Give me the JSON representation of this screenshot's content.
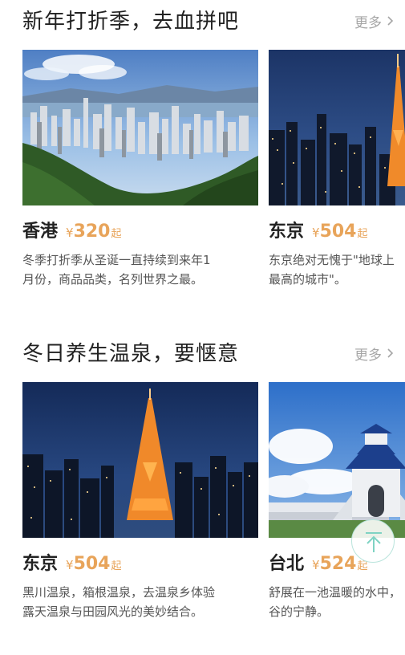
{
  "sections": [
    {
      "title": "新年打折季，去血拼吧",
      "more": "更多",
      "cards": [
        {
          "city": "香港",
          "price_currency": "¥",
          "price": "320",
          "price_suffix": "起",
          "desc_lines": [
            "冬季打折季从圣诞一直持续到来年1",
            "月份，商品品类，名列世界之最。"
          ]
        },
        {
          "city": "东京",
          "price_currency": "¥",
          "price": "504",
          "price_suffix": "起",
          "desc_lines": [
            "东京绝对无愧于\"地球上",
            "最高的城市\"。"
          ]
        }
      ]
    },
    {
      "title": "冬日养生温泉，要惬意",
      "more": "更多",
      "cards": [
        {
          "city": "东京",
          "price_currency": "¥",
          "price": "504",
          "price_suffix": "起",
          "desc_lines": [
            "黑川温泉，箱根温泉，去温泉乡体验",
            "露天温泉与田园风光的美妙结合。"
          ]
        },
        {
          "city": "台北",
          "price_currency": "¥",
          "price": "524",
          "price_suffix": "起",
          "desc_lines": [
            "舒展在一池温暖的水中，",
            "谷的宁静。"
          ]
        }
      ]
    }
  ],
  "colors": {
    "price": "#e8a45a",
    "more": "#a6a6a6",
    "back_to_top": "#7fd3c3"
  },
  "icons": {
    "more": "chevron-right-icon",
    "back_to_top": "arrow-up-icon"
  }
}
